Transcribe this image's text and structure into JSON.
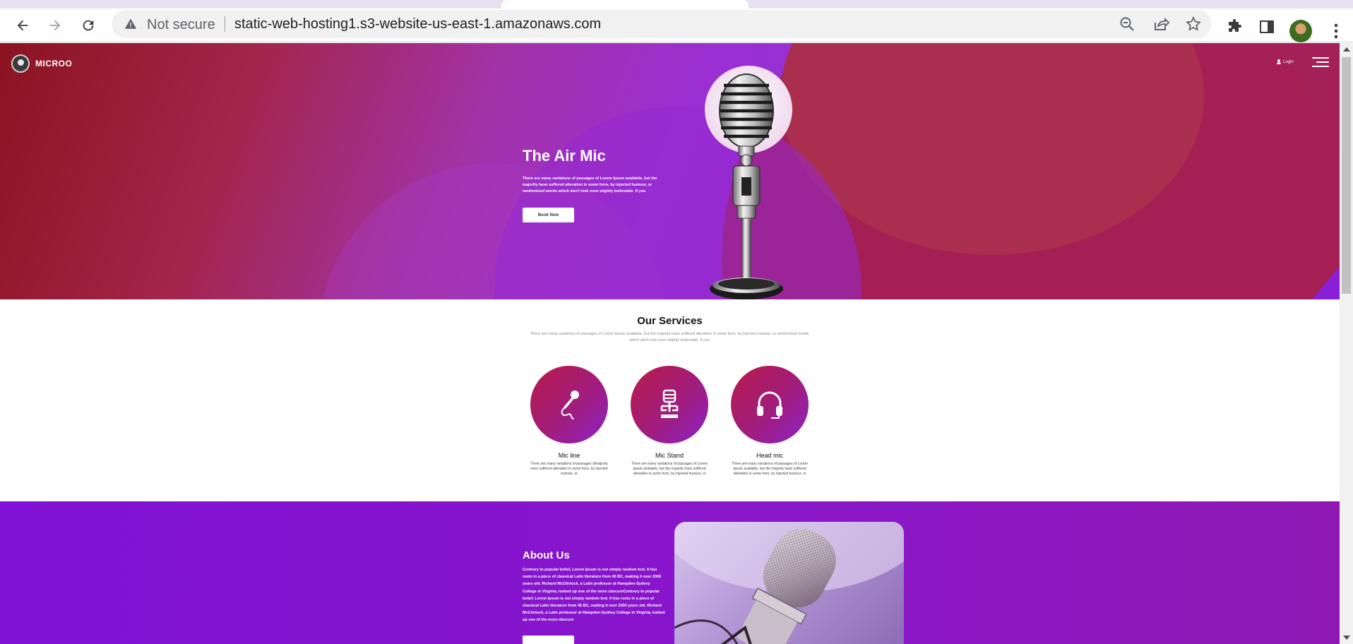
{
  "browser": {
    "not_secure_label": "Not secure",
    "url": "static-web-hosting1.s3-website-us-east-1.amazonaws.com"
  },
  "site": {
    "logo_text": "MICROO",
    "login_label": "Login"
  },
  "hero": {
    "title": "The Air Mic",
    "description": "There are many variations of passages of Lorem Ipsum available, but the majority have suffered alteration in some form, by injected humour, or randomised words which don't look even slightly believable. If you",
    "button_label": "Book Now"
  },
  "services": {
    "title": "Our Services",
    "description": "There are many variations of passages of Lorem Ipsum available, but the majority have suffered alteration in some form, by injected humour, or randomised words which don't look even slightly believable. If you",
    "items": [
      {
        "name": "Mic line",
        "icon": "microphone-cable-icon",
        "description": "There are many variations of passages ofmajority have suffered alteration in some form, by injected humour, or"
      },
      {
        "name": "Mic Stand",
        "icon": "mic-stand-icon",
        "description": "There are many variations of passages of Lorem Ipsum available, but the majority have suffered alteration in some form, by injected humour, or"
      },
      {
        "name": "Head mic",
        "icon": "headphones-icon",
        "description": "There are many variations of passages of Lorem Ipsum available, but the majority have suffered alteration in some form, by injected humour, or"
      }
    ]
  },
  "about": {
    "title": "About Us",
    "text": "Contrary to popular belief, Lorem Ipsum is not simply random text. It has roots in a piece of classical Latin literature from 45 BC, making it over 2000 years old. Richard McClintock, a Latin professor at Hampden-Sydney College in Virginia, looked up one of the more obscureContrary to popular belief, Lorem Ipsum is not simply random text. It has roots in a piece of classical Latin literature from 45 BC, making it over 2000 years old. Richard McClintock, a Latin professor at Hampden-Sydney College in Virginia, looked up one of the more obscure"
  },
  "colors": {
    "accent_purple": "#8a16c9",
    "accent_crimson": "#a51f55",
    "service_gradient_start": "#b81a48",
    "service_gradient_end": "#8b22c6"
  }
}
